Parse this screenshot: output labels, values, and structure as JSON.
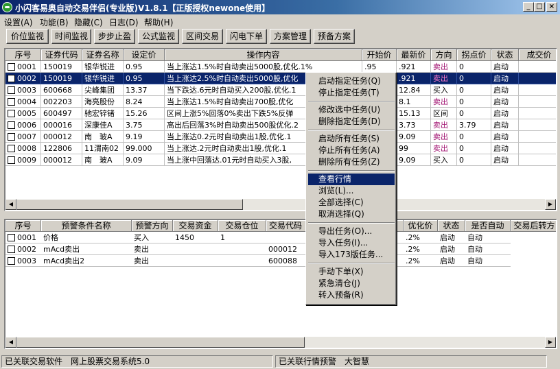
{
  "window": {
    "title": "小闪客易奥自动交易伴侣(专业版)V1.8.1【正版授权newone使用】"
  },
  "window_buttons": {
    "minimize": "_",
    "maximize": "□",
    "close": "×"
  },
  "menu": [
    "设置(A)",
    "功能(B)",
    "隐藏(C)",
    "日志(D)",
    "帮助(H)"
  ],
  "toolbar": [
    "价位监视",
    "时间监视",
    "步步止盈",
    "公式监视",
    "区间交易",
    "闪电下单",
    "方案管理",
    "预备方案"
  ],
  "top_table": {
    "headers": [
      "序号",
      "证券代码",
      "证券名称",
      "设定价",
      "操作内容",
      "开始价",
      "最新价",
      "方向",
      "拐点价",
      "状态",
      "成交价"
    ],
    "rows": [
      {
        "no": "0001",
        "code": "150019",
        "name": "银华锐进",
        "price": "0.95",
        "op": "当上涨达1.5%时自动卖出5000股,优化.1%",
        "start": ".95",
        "last": ".921",
        "dir": "卖出",
        "turn": "0",
        "status": "启动",
        "deal": ""
      },
      {
        "no": "0002",
        "code": "150019",
        "name": "银华锐进",
        "price": "0.95",
        "op": "当上涨达2.5%时自动卖出5000股,优化",
        "start": "",
        "last": ".921",
        "dir": "卖出",
        "turn": "0",
        "status": "启动",
        "deal": ""
      },
      {
        "no": "0003",
        "code": "600668",
        "name": "尖峰集团",
        "price": "13.37",
        "op": "当下跌达.6元时自动买入200股,优化.1",
        "start": "",
        "last": "12.84",
        "dir": "买入",
        "turn": "0",
        "status": "启动",
        "deal": ""
      },
      {
        "no": "0004",
        "code": "002203",
        "name": "海亮股份",
        "price": "8.24",
        "op": "当上涨达1.5%时自动卖出700股,优化",
        "start": "",
        "last": "8.1",
        "dir": "卖出",
        "turn": "0",
        "status": "启动",
        "deal": ""
      },
      {
        "no": "0005",
        "code": "600497",
        "name": "驰宏锌锗",
        "price": "15.26",
        "op": "区间上涨5%回落0%卖出下跌5%反弹",
        "start": "",
        "last": "15.13",
        "dir": "区间",
        "turn": "0",
        "status": "启动",
        "deal": ""
      },
      {
        "no": "0006",
        "code": "000016",
        "name": "深康佳A",
        "price": "3.75",
        "op": "高出后回落3%时自动卖出500股优化.2",
        "start": "",
        "last": "3.73",
        "dir": "卖出",
        "turn": "3.79",
        "status": "启动",
        "deal": ""
      },
      {
        "no": "0007",
        "code": "000012",
        "name": "南　玻A",
        "price": "9.19",
        "op": "当上涨达0.2元时自动卖出1股,优化.1",
        "start": "",
        "last": "9.09",
        "dir": "卖出",
        "turn": "0",
        "status": "启动",
        "deal": ""
      },
      {
        "no": "0008",
        "code": "122806",
        "name": "11渭南02",
        "price": "99.000",
        "op": "当上涨达.2元时自动卖出1股,优化.1",
        "start": "",
        "last": "99",
        "dir": "卖出",
        "turn": "0",
        "status": "启动",
        "deal": ""
      },
      {
        "no": "0009",
        "code": "000012",
        "name": "南　玻A",
        "price": "9.09",
        "op": "当上涨中回落达.01元时自动买入3股,",
        "start": "",
        "last": "9.09",
        "dir": "买入",
        "turn": "0",
        "status": "启动",
        "deal": ""
      }
    ]
  },
  "bottom_table": {
    "headers": [
      "序号",
      "预警条件名称",
      "预警方向",
      "交易资金",
      "交易仓位",
      "交易代码",
      "优化价",
      "状态",
      "是否自动",
      "交易后转方"
    ],
    "rows": [
      {
        "no": "0001",
        "name": "价格",
        "dir": "买入",
        "fund": "1450",
        "pos": "1",
        "code": "",
        "opt": ".2%",
        "status": "启动",
        "auto": "自动"
      },
      {
        "no": "0002",
        "name": "mAcd卖出",
        "dir": "卖出",
        "fund": "",
        "pos": "",
        "code": "000012",
        "opt": ".2%",
        "status": "启动",
        "auto": "自动"
      },
      {
        "no": "0003",
        "name": "mAcd卖出2",
        "dir": "卖出",
        "fund": "",
        "pos": "",
        "code": "600088",
        "opt": ".2%",
        "status": "启动",
        "auto": "自动"
      }
    ]
  },
  "context_menu": {
    "groups": [
      [
        "启动指定任务(Q)",
        "停止指定任务(T)"
      ],
      [
        "修改选中任务(U)",
        "删除指定任务(D)"
      ],
      [
        "启动所有任务(S)",
        "停止所有任务(A)",
        "删除所有任务(Z)"
      ],
      [
        "查看行情",
        "浏览(L)...",
        "全部选择(C)",
        "取消选择(Q)"
      ],
      [
        "导出任务(O)...",
        "导入任务(I)...",
        "导入173版任务..."
      ],
      [
        "手动下单(X)",
        "紧急清仓(J)",
        "转入预备(R)"
      ]
    ],
    "highlighted": "查看行情"
  },
  "status": {
    "left": "已关联交易软件　网上股票交易系统5.0",
    "right": "已关联行情预警　大智慧"
  },
  "colors": {
    "selection": "#0a246a",
    "sell_text": "#a01070",
    "window_bg": "#d4d0c8"
  }
}
